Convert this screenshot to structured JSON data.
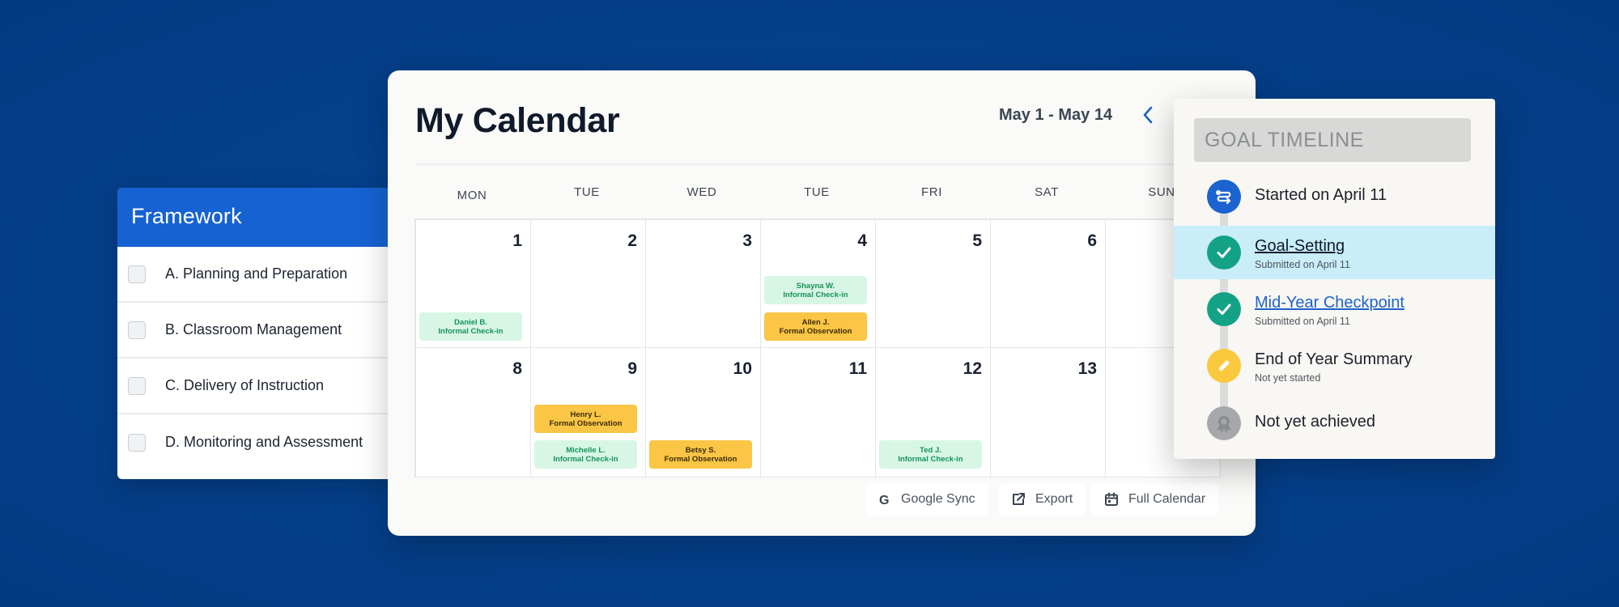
{
  "framework": {
    "title": "Framework",
    "items": [
      {
        "label": "A. Planning and Preparation"
      },
      {
        "label": "B. Classroom Management"
      },
      {
        "label": "C. Delivery of Instruction"
      },
      {
        "label": "D. Monitoring and Assessment"
      }
    ]
  },
  "calendar": {
    "title": "My Calendar",
    "date_range": "May 1 - May 14",
    "weekdays": [
      "MON",
      "TUE",
      "WED",
      "TUE",
      "FRI",
      "SAT",
      "SUN"
    ],
    "week1": [
      "1",
      "2",
      "3",
      "4",
      "5",
      "6",
      ""
    ],
    "week2": [
      "8",
      "9",
      "10",
      "11",
      "12",
      "13",
      ""
    ],
    "events": {
      "daniel": {
        "name": "Daniel B.",
        "type": "Informal Check-in"
      },
      "shayna": {
        "name": "Shayna W.",
        "type": "Informal Check-in"
      },
      "allen": {
        "name": "Allen J.",
        "type": "Formal Observation"
      },
      "henry": {
        "name": "Henry L.",
        "type": "Formal Observation"
      },
      "michelle": {
        "name": "Michelle L.",
        "type": "Informal Check-in"
      },
      "betsy": {
        "name": "Betsy S.",
        "type": "Formal Observation"
      },
      "ted": {
        "name": "Ted J.",
        "type": "Informal Check-in"
      }
    },
    "actions": {
      "google_sync": "Google Sync",
      "export": "Export",
      "full_calendar": "Full Calendar"
    }
  },
  "timeline": {
    "title": "GOAL TIMELINE",
    "items": [
      {
        "title": "Started on April 11",
        "subtitle": ""
      },
      {
        "title": "Goal-Setting",
        "subtitle": "Submitted on April 11"
      },
      {
        "title": "Mid-Year Checkpoint",
        "subtitle": "Submitted on April 11"
      },
      {
        "title": "End of Year Summary",
        "subtitle": "Not yet started"
      },
      {
        "title": "Not yet achieved",
        "subtitle": ""
      }
    ]
  },
  "colors": {
    "background": "#053f8a",
    "framework_header": "#1662d2",
    "informal_event": "#d8f6e5",
    "formal_event": "#fbc545",
    "timeline_highlight": "#c9edf9",
    "icon_blue": "#1b63cf",
    "icon_green": "#14a286",
    "icon_yellow": "#fbc93d",
    "icon_gray": "#a6a8ab"
  }
}
